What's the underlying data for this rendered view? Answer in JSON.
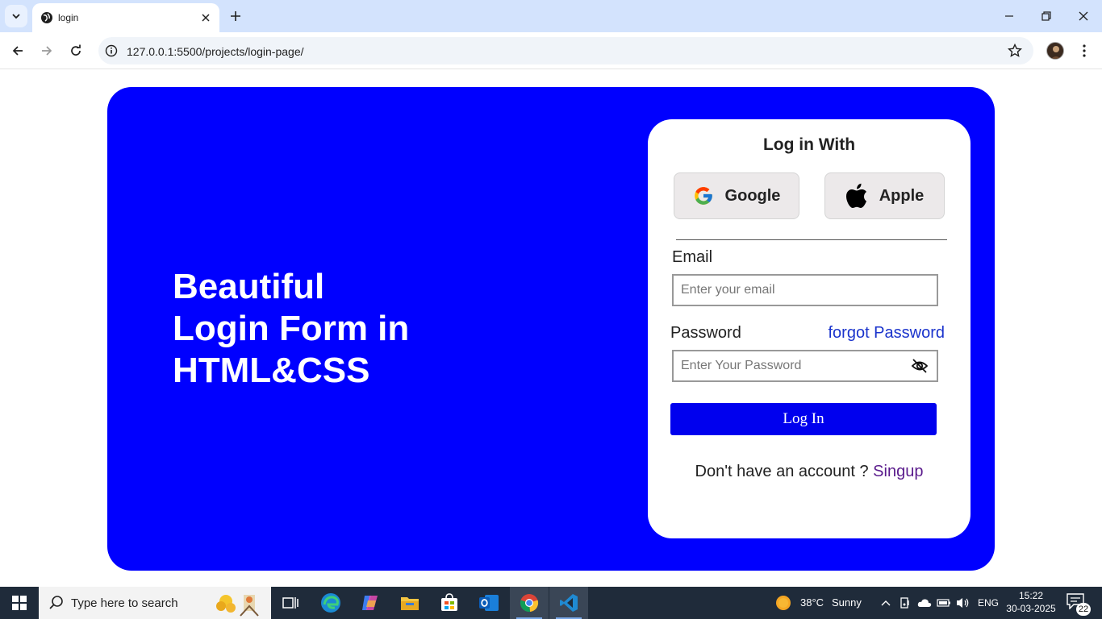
{
  "browser": {
    "tab_title": "login",
    "url": "127.0.0.1:5500/projects/login-page/"
  },
  "hero": {
    "heading_line1": "Beautiful",
    "heading_line2": "Login Form in",
    "heading_line3": "HTML&CSS",
    "background_color": "#0000ff"
  },
  "login_card": {
    "title": "Log in With",
    "google_label": "Google",
    "apple_label": "Apple",
    "email_label": "Email",
    "email_placeholder": "Enter your email",
    "password_label": "Password",
    "forgot_password": "forgot Password",
    "password_placeholder": "Enter Your Password",
    "login_button": "Log In",
    "signup_prompt": "Don't have an account ? ",
    "signup_link": "Singup"
  },
  "taskbar": {
    "search_placeholder": "Type here to search",
    "weather_temp": "38°C",
    "weather_text": "Sunny",
    "language": "ENG",
    "time": "15:22",
    "date": "30-03-2025",
    "notification_count": "22"
  }
}
